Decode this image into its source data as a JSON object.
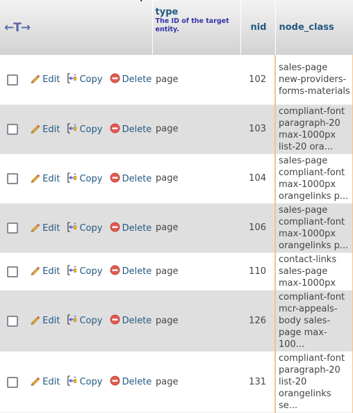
{
  "header": {
    "resize_arrows": "←T→",
    "columns": [
      {
        "key": "type",
        "label": "type",
        "description": "The ID of the target entity."
      },
      {
        "key": "nid",
        "label": "nid"
      },
      {
        "key": "node_class",
        "label": "node_class"
      }
    ]
  },
  "actions": {
    "edit": "Edit",
    "copy": "Copy",
    "delete": "Delete"
  },
  "colors": {
    "link": "#235a81",
    "row_alt": "#dfdfdf",
    "highlight_border": "#f6c38d"
  },
  "rows": [
    {
      "type": "page",
      "nid": "102",
      "node_class": "sales-page new-providers-forms-materials"
    },
    {
      "type": "page",
      "nid": "103",
      "node_class": "compliant-font paragraph-20 max-1000px list-20 ora..."
    },
    {
      "type": "page",
      "nid": "104",
      "node_class": "sales-page compliant-font max-1000px orangelinks p..."
    },
    {
      "type": "page",
      "nid": "106",
      "node_class": "sales-page compliant-font max-1000px orangelinks p..."
    },
    {
      "type": "page",
      "nid": "110",
      "node_class": "contact-links sales-page max-1000px"
    },
    {
      "type": "page",
      "nid": "126",
      "node_class": "compliant-font mcr-appeals-body sales-page max-100..."
    },
    {
      "type": "page",
      "nid": "131",
      "node_class": "compliant-font paragraph-20 list-20 orangelinks se..."
    }
  ]
}
